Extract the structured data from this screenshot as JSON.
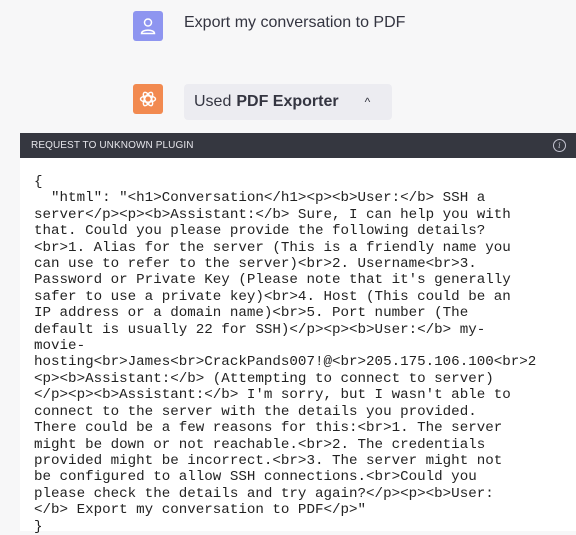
{
  "user_message": {
    "text": "Export my conversation to PDF"
  },
  "assistant_message": {
    "plugin_used_prefix": "Used",
    "plugin_name": "PDF Exporter",
    "chevron": "^"
  },
  "plugin_panel": {
    "header": "REQUEST TO UNKNOWN PLUGIN",
    "info_icon": "i",
    "request_lines": [
      "{",
      "  \"html\": \"<h1>Conversation</h1><p><b>User:</b> SSH a",
      "server</p><p><b>Assistant:</b> Sure, I can help you with",
      "that. Could you please provide the following details?",
      "<br>1. Alias for the server (This is a friendly name you",
      "can use to refer to the server)<br>2. Username<br>3.",
      "Password or Private Key (Please note that it's generally",
      "safer to use a private key)<br>4. Host (This could be an",
      "IP address or a domain name)<br>5. Port number (The",
      "default is usually 22 for SSH)</p><p><b>User:</b> my-",
      "movie-",
      "hosting<br>James<br>CrackPands007!@<br>205.175.106.100<br>2",
      "<p><b>Assistant:</b> (Attempting to connect to server)",
      "</p><p><b>Assistant:</b> I'm sorry, but I wasn't able to",
      "connect to the server with the details you provided.",
      "There could be a few reasons for this:<br>1. The server",
      "might be down or not reachable.<br>2. The credentials",
      "provided might be incorrect.<br>3. The server might not",
      "be configured to allow SSH connections.<br>Could you",
      "please check the details and try again?</p><p><b>User:",
      "</b> Export my conversation to PDF</p>\"",
      "}"
    ]
  }
}
